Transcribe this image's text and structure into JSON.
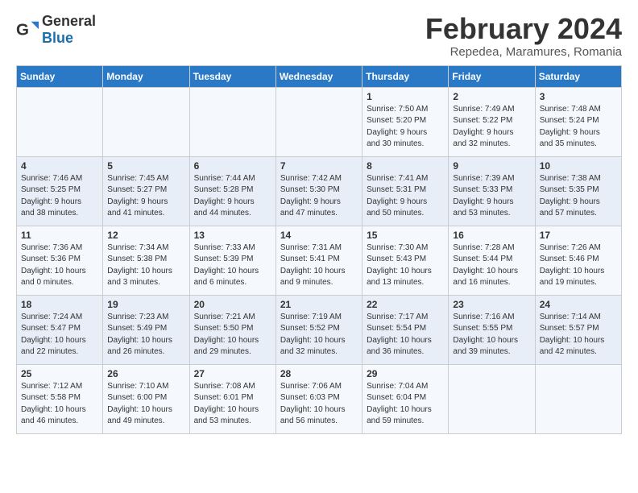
{
  "logo": {
    "general": "General",
    "blue": "Blue"
  },
  "header": {
    "month": "February 2024",
    "location": "Repedea, Maramures, Romania"
  },
  "weekdays": [
    "Sunday",
    "Monday",
    "Tuesday",
    "Wednesday",
    "Thursday",
    "Friday",
    "Saturday"
  ],
  "weeks": [
    [
      {
        "day": "",
        "info": ""
      },
      {
        "day": "",
        "info": ""
      },
      {
        "day": "",
        "info": ""
      },
      {
        "day": "",
        "info": ""
      },
      {
        "day": "1",
        "info": "Sunrise: 7:50 AM\nSunset: 5:20 PM\nDaylight: 9 hours\nand 30 minutes."
      },
      {
        "day": "2",
        "info": "Sunrise: 7:49 AM\nSunset: 5:22 PM\nDaylight: 9 hours\nand 32 minutes."
      },
      {
        "day": "3",
        "info": "Sunrise: 7:48 AM\nSunset: 5:24 PM\nDaylight: 9 hours\nand 35 minutes."
      }
    ],
    [
      {
        "day": "4",
        "info": "Sunrise: 7:46 AM\nSunset: 5:25 PM\nDaylight: 9 hours\nand 38 minutes."
      },
      {
        "day": "5",
        "info": "Sunrise: 7:45 AM\nSunset: 5:27 PM\nDaylight: 9 hours\nand 41 minutes."
      },
      {
        "day": "6",
        "info": "Sunrise: 7:44 AM\nSunset: 5:28 PM\nDaylight: 9 hours\nand 44 minutes."
      },
      {
        "day": "7",
        "info": "Sunrise: 7:42 AM\nSunset: 5:30 PM\nDaylight: 9 hours\nand 47 minutes."
      },
      {
        "day": "8",
        "info": "Sunrise: 7:41 AM\nSunset: 5:31 PM\nDaylight: 9 hours\nand 50 minutes."
      },
      {
        "day": "9",
        "info": "Sunrise: 7:39 AM\nSunset: 5:33 PM\nDaylight: 9 hours\nand 53 minutes."
      },
      {
        "day": "10",
        "info": "Sunrise: 7:38 AM\nSunset: 5:35 PM\nDaylight: 9 hours\nand 57 minutes."
      }
    ],
    [
      {
        "day": "11",
        "info": "Sunrise: 7:36 AM\nSunset: 5:36 PM\nDaylight: 10 hours\nand 0 minutes."
      },
      {
        "day": "12",
        "info": "Sunrise: 7:34 AM\nSunset: 5:38 PM\nDaylight: 10 hours\nand 3 minutes."
      },
      {
        "day": "13",
        "info": "Sunrise: 7:33 AM\nSunset: 5:39 PM\nDaylight: 10 hours\nand 6 minutes."
      },
      {
        "day": "14",
        "info": "Sunrise: 7:31 AM\nSunset: 5:41 PM\nDaylight: 10 hours\nand 9 minutes."
      },
      {
        "day": "15",
        "info": "Sunrise: 7:30 AM\nSunset: 5:43 PM\nDaylight: 10 hours\nand 13 minutes."
      },
      {
        "day": "16",
        "info": "Sunrise: 7:28 AM\nSunset: 5:44 PM\nDaylight: 10 hours\nand 16 minutes."
      },
      {
        "day": "17",
        "info": "Sunrise: 7:26 AM\nSunset: 5:46 PM\nDaylight: 10 hours\nand 19 minutes."
      }
    ],
    [
      {
        "day": "18",
        "info": "Sunrise: 7:24 AM\nSunset: 5:47 PM\nDaylight: 10 hours\nand 22 minutes."
      },
      {
        "day": "19",
        "info": "Sunrise: 7:23 AM\nSunset: 5:49 PM\nDaylight: 10 hours\nand 26 minutes."
      },
      {
        "day": "20",
        "info": "Sunrise: 7:21 AM\nSunset: 5:50 PM\nDaylight: 10 hours\nand 29 minutes."
      },
      {
        "day": "21",
        "info": "Sunrise: 7:19 AM\nSunset: 5:52 PM\nDaylight: 10 hours\nand 32 minutes."
      },
      {
        "day": "22",
        "info": "Sunrise: 7:17 AM\nSunset: 5:54 PM\nDaylight: 10 hours\nand 36 minutes."
      },
      {
        "day": "23",
        "info": "Sunrise: 7:16 AM\nSunset: 5:55 PM\nDaylight: 10 hours\nand 39 minutes."
      },
      {
        "day": "24",
        "info": "Sunrise: 7:14 AM\nSunset: 5:57 PM\nDaylight: 10 hours\nand 42 minutes."
      }
    ],
    [
      {
        "day": "25",
        "info": "Sunrise: 7:12 AM\nSunset: 5:58 PM\nDaylight: 10 hours\nand 46 minutes."
      },
      {
        "day": "26",
        "info": "Sunrise: 7:10 AM\nSunset: 6:00 PM\nDaylight: 10 hours\nand 49 minutes."
      },
      {
        "day": "27",
        "info": "Sunrise: 7:08 AM\nSunset: 6:01 PM\nDaylight: 10 hours\nand 53 minutes."
      },
      {
        "day": "28",
        "info": "Sunrise: 7:06 AM\nSunset: 6:03 PM\nDaylight: 10 hours\nand 56 minutes."
      },
      {
        "day": "29",
        "info": "Sunrise: 7:04 AM\nSunset: 6:04 PM\nDaylight: 10 hours\nand 59 minutes."
      },
      {
        "day": "",
        "info": ""
      },
      {
        "day": "",
        "info": ""
      }
    ]
  ]
}
